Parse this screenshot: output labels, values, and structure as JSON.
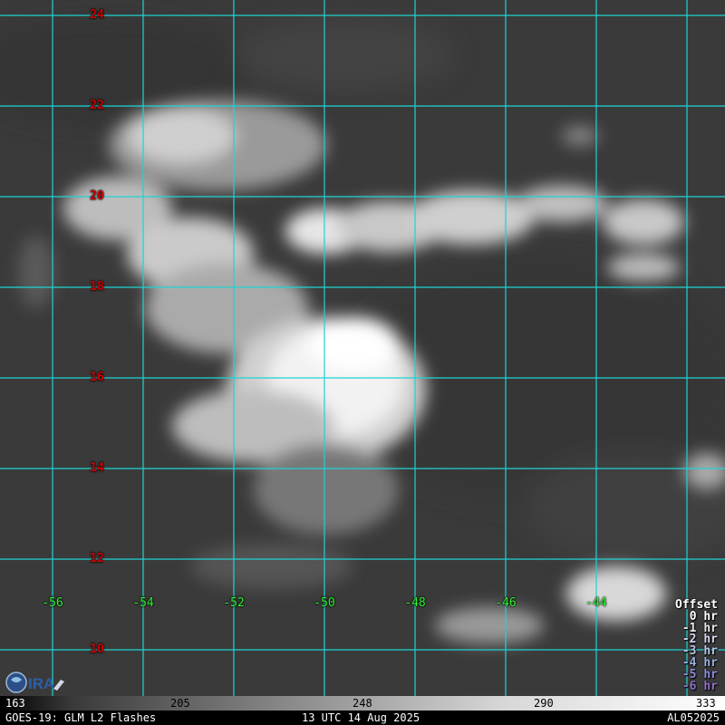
{
  "map": {
    "lat_labels": [
      "24",
      "22",
      "20",
      "18",
      "16",
      "14",
      "12",
      "10"
    ],
    "lon_labels": [
      "-56",
      "-54",
      "-52",
      "-50",
      "-48",
      "-46",
      "-44"
    ],
    "grid_color": "#1fd3d3",
    "lat_label_color": "#d40000",
    "lon_label_color": "#2df22d"
  },
  "offset_legend": {
    "title": "Offset",
    "items": [
      {
        "label": "0 hr",
        "color": "#ffffff"
      },
      {
        "label": "-1 hr",
        "color": "#e8e8e8"
      },
      {
        "label": "-2 hr",
        "color": "#d6d6f0"
      },
      {
        "label": "-3 hr",
        "color": "#b8c8e8"
      },
      {
        "label": "-4 hr",
        "color": "#9ab0e0"
      },
      {
        "label": "-5 hr",
        "color": "#8c8ce0"
      },
      {
        "label": "-6 hr",
        "color": "#9070c8"
      }
    ]
  },
  "colorbar": {
    "ticks": [
      "163",
      "205",
      "248",
      "290",
      "333"
    ]
  },
  "footer": {
    "left": "GOES-19: GLM L2 Flashes",
    "center": "13 UTC 14 Aug 2025",
    "right": "AL052025"
  },
  "logo": {
    "icon": "cira-logo"
  }
}
